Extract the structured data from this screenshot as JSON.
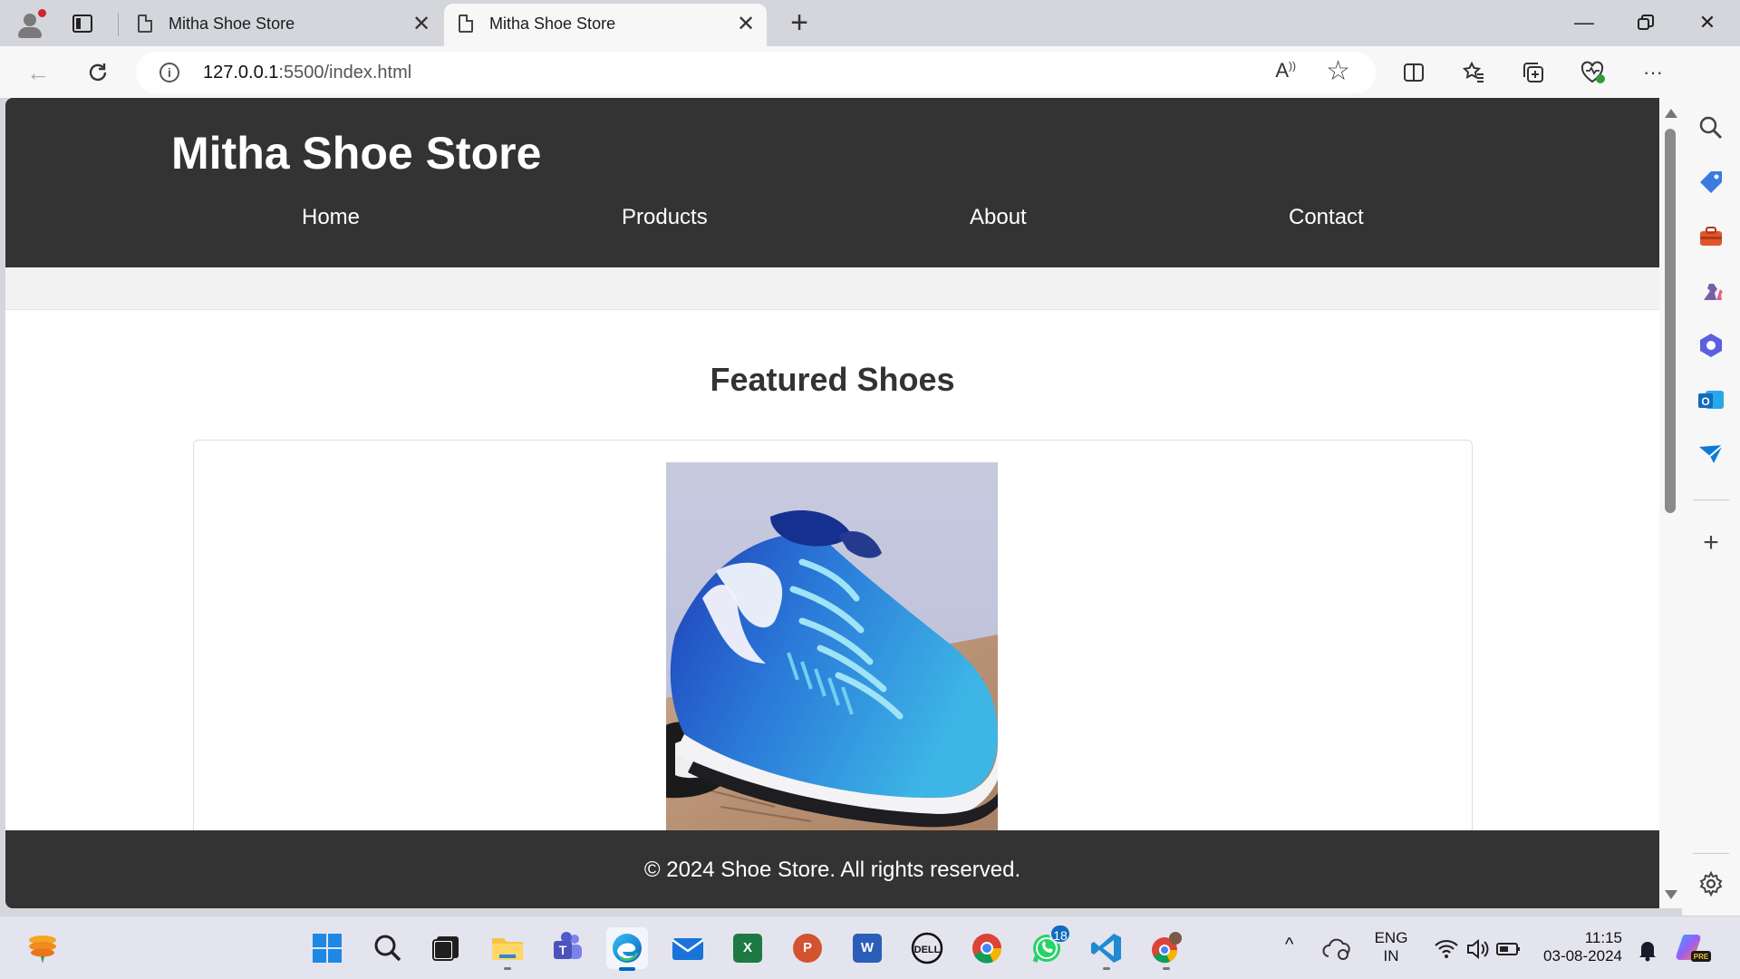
{
  "browser": {
    "tabs": [
      {
        "title": "Mitha Shoe Store",
        "active": false
      },
      {
        "title": "Mitha Shoe Store",
        "active": true
      }
    ],
    "address": {
      "host": "127.0.0.1",
      "rest": ":5500/index.html"
    }
  },
  "site": {
    "title": "Mitha Shoe Store",
    "nav": [
      "Home",
      "Products",
      "About",
      "Contact"
    ],
    "section_title": "Featured Shoes",
    "footer": "© 2024 Shoe Store. All rights reserved.",
    "colors": {
      "header_bg": "#333333",
      "band_bg": "#f2f2f2",
      "text": "#333333"
    }
  },
  "taskbar": {
    "whatsapp_badge": "18",
    "language": {
      "line1": "ENG",
      "line2": "IN"
    },
    "clock": {
      "time": "11:15",
      "date": "03-08-2024"
    }
  }
}
